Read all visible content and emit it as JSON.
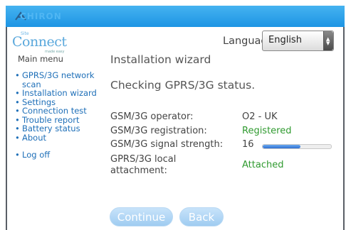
{
  "header": {
    "brand": "CHIRON"
  },
  "logo": {
    "small_text": "Site",
    "name": "Connect",
    "tagline": "made easy"
  },
  "language": {
    "label": "Language:",
    "selected": "English"
  },
  "sidebar": {
    "title": "Main menu",
    "items": [
      {
        "label": "GPRS/3G network scan"
      },
      {
        "label": "Installation wizard"
      },
      {
        "label": "Settings"
      },
      {
        "label": "Connection test"
      },
      {
        "label": "Trouble report"
      },
      {
        "label": "Battery status"
      },
      {
        "label": "About"
      },
      {
        "label": "Log off"
      }
    ]
  },
  "main": {
    "title": "Installation wizard",
    "status": "Checking GPRS/3G status.",
    "fields": [
      {
        "label": "GSM/3G operator:",
        "value": "O2 - UK"
      },
      {
        "label": "GSM/3G registration:",
        "value": "Registered"
      },
      {
        "label": "GSM/3G signal strength:",
        "value": "16",
        "level": 0.55
      },
      {
        "label": "GPRS/3G local attachment:",
        "value": "Attached"
      }
    ]
  },
  "buttons": {
    "continue": "Continue",
    "back": "Back"
  },
  "colors": {
    "accent": "#1d95e4",
    "link": "#1e6fb8",
    "ok": "#2f9a2f"
  }
}
